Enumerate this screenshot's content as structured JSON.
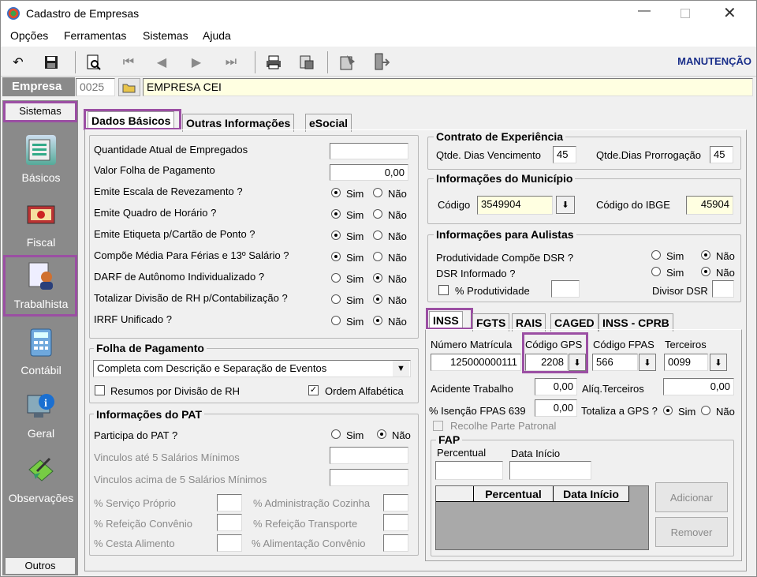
{
  "window": {
    "title": "Cadastro de Empresas"
  },
  "menu": [
    "Opções",
    "Ferramentas",
    "Sistemas",
    "Ajuda"
  ],
  "toolbar": {
    "mode": "MANUTENÇÃO"
  },
  "empresa": {
    "label": "Empresa",
    "code": "0025",
    "name": "EMPRESA CEI"
  },
  "sidebar": {
    "header": "Sistemas",
    "footer": "Outros",
    "items": [
      {
        "label": "Básicos",
        "icon": "basicos-icon"
      },
      {
        "label": "Fiscal",
        "icon": "fiscal-icon"
      },
      {
        "label": "Trabalhista",
        "icon": "trabalhista-icon"
      },
      {
        "label": "Contábil",
        "icon": "contabil-icon"
      },
      {
        "label": "Geral",
        "icon": "geral-icon"
      },
      {
        "label": "Observações",
        "icon": "observacoes-icon"
      }
    ]
  },
  "tabs": [
    "Dados Básicos",
    "Outras Informações",
    "eSocial"
  ],
  "basic": {
    "qtd_label": "Quantidade Atual de Empregados",
    "qtd_value": "",
    "folha_label": "Valor Folha de Pagamento",
    "folha_value": "0,00",
    "yes": "Sim",
    "no": "Não",
    "questions": [
      "Emite Escala de Revezamento ?",
      "Emite Quadro de Horário ?",
      "Emite Etiqueta p/Cartão de Ponto ?",
      "Compõe Média Para Férias e 13º Salário ?",
      "DARF de Autônomo Individualizado ?",
      "Totalizar Divisão de RH p/Contabilização ?",
      "IRRF Unificado ?"
    ],
    "answers": [
      "Sim",
      "Sim",
      "Sim",
      "Sim",
      "Não",
      "Não",
      "Não"
    ]
  },
  "folha": {
    "title": "Folha de Pagamento",
    "select": "Completa com Descrição e Separação de Eventos",
    "resumo": "Resumos por Divisão de RH",
    "ordem": "Ordem Alfabética"
  },
  "pat": {
    "title": "Informações do PAT",
    "participa": "Participa do PAT ?",
    "participa_value": "Não",
    "v1": "Vinculos até 5 Salários Mínimos",
    "v2": "Vinculos acima de 5 Salários Mínimos",
    "p1": "% Serviço Próprio",
    "p2": "% Administração Cozinha",
    "p3": "% Refeição Convênio",
    "p4": "% Refeição Transporte",
    "p5": "% Cesta Alimento",
    "p6": "% Alimentação Convênio"
  },
  "contrato": {
    "title": "Contrato de Experiência",
    "venc_label": "Qtde. Dias Vencimento",
    "venc": "45",
    "prorr_label": "Qtde.Dias Prorrogação",
    "prorr": "45"
  },
  "municipio": {
    "title": "Informações do Município",
    "codigo_label": "Código",
    "codigo": "3549904",
    "ibge_label": "Código do IBGE",
    "ibge": "45904"
  },
  "aulistas": {
    "title": "Informações para Aulistas",
    "q1": "Produtividade Compõe DSR ?",
    "q2": "DSR Informado ?",
    "a1": "Não",
    "a2": "Não",
    "prod": "% Produtividade",
    "divisor": "Divisor DSR"
  },
  "subtabs": [
    "INSS",
    "FGTS",
    "RAIS",
    "CAGED",
    "INSS - CPRB"
  ],
  "inss": {
    "matricula_label": "Número Matrícula",
    "matricula": "125000000111",
    "gps_label": "Código GPS",
    "gps": "2208",
    "fpas_label": "Código FPAS",
    "fpas": "566",
    "terceiros_label": "Terceiros",
    "terceiros": "0099",
    "acidente_label": "Acidente Trabalho",
    "acidente": "0,00",
    "aliq_label": "Alíq.Terceiros",
    "aliq": "0,00",
    "isencao_label": "% Isenção FPAS 639",
    "isencao": "0,00",
    "totaliza_label": "Totaliza a GPS ?",
    "totaliza": "Sim",
    "recolhe": "Recolhe Parte Patronal"
  },
  "fap": {
    "title": "FAP",
    "perc_label": "Percentual",
    "data_label": "Data Início",
    "col1": "Percentual",
    "col2": "Data Início",
    "add": "Adicionar",
    "remove": "Remover"
  }
}
